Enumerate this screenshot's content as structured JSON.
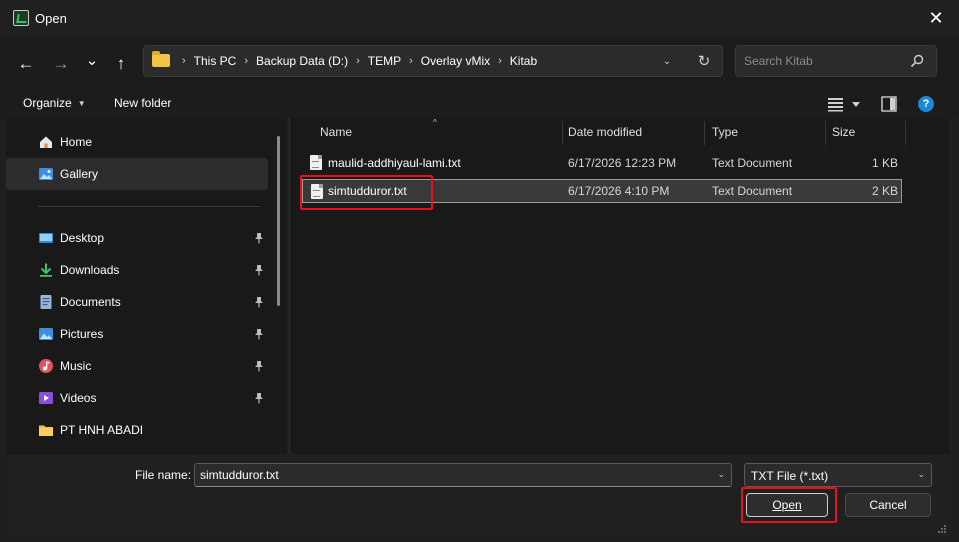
{
  "window": {
    "title": "Open",
    "close_glyph": "✕"
  },
  "nav": {
    "back_glyph": "←",
    "forward_glyph": "→",
    "recent_glyph": "⌄",
    "up_glyph": "↑",
    "breadcrumbs": [
      "This PC",
      "Backup Data (D:)",
      "TEMP",
      "Overlay vMix",
      "Kitab"
    ],
    "crumb_separator": "›",
    "dropdown_glyph": "⌄",
    "refresh_glyph": "↻"
  },
  "search": {
    "placeholder": "Search Kitab",
    "value": ""
  },
  "toolbar": {
    "organize_label": "Organize",
    "new_folder_label": "New folder",
    "help_glyph": "?"
  },
  "sidebar": {
    "items": [
      {
        "label": "Home",
        "icon": "home-icon",
        "pinned": false,
        "selected": false
      },
      {
        "label": "Gallery",
        "icon": "gallery-icon",
        "pinned": false,
        "selected": true
      },
      {
        "label": "Desktop",
        "icon": "desktop-icon",
        "pinned": true,
        "selected": false
      },
      {
        "label": "Downloads",
        "icon": "downloads-icon",
        "pinned": true,
        "selected": false
      },
      {
        "label": "Documents",
        "icon": "documents-icon",
        "pinned": true,
        "selected": false
      },
      {
        "label": "Pictures",
        "icon": "pictures-icon",
        "pinned": true,
        "selected": false
      },
      {
        "label": "Music",
        "icon": "music-icon",
        "pinned": true,
        "selected": false
      },
      {
        "label": "Videos",
        "icon": "videos-icon",
        "pinned": true,
        "selected": false
      },
      {
        "label": "PT HNH ABADI",
        "icon": "folder-icon",
        "pinned": false,
        "selected": false
      }
    ]
  },
  "files": {
    "columns": [
      "Name",
      "Date modified",
      "Type",
      "Size"
    ],
    "sort_glyph": "^",
    "rows": [
      {
        "name": "maulid-addhiyaul-lami.txt",
        "date": "6/17/2026 12:23 PM",
        "type": "Text Document",
        "size": "1 KB",
        "selected": false
      },
      {
        "name": "simtudduror.txt",
        "date": "6/17/2026 4:10 PM",
        "type": "Text Document",
        "size": "2 KB",
        "selected": true
      }
    ]
  },
  "footer": {
    "filename_label": "File name:",
    "filename_value": "simtudduror.txt",
    "dropdown_glyph": "⌄",
    "filter_value": "TXT File (*.txt)",
    "open_label": "Open",
    "cancel_label": "Cancel"
  },
  "colors": {
    "highlight": "#e8101c",
    "accent": "#1e88d8",
    "folder": "#f4c247"
  }
}
